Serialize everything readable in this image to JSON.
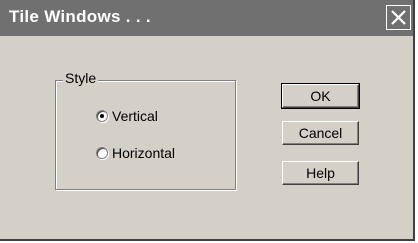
{
  "window": {
    "title": "Tile Windows . . ."
  },
  "style_group": {
    "label": "Style",
    "options": [
      {
        "label": "Vertical",
        "selected": true
      },
      {
        "label": "Horizontal",
        "selected": false
      }
    ]
  },
  "buttons": {
    "ok": "OK",
    "cancel": "Cancel",
    "help": "Help"
  },
  "icons": {
    "close": "close-icon"
  }
}
